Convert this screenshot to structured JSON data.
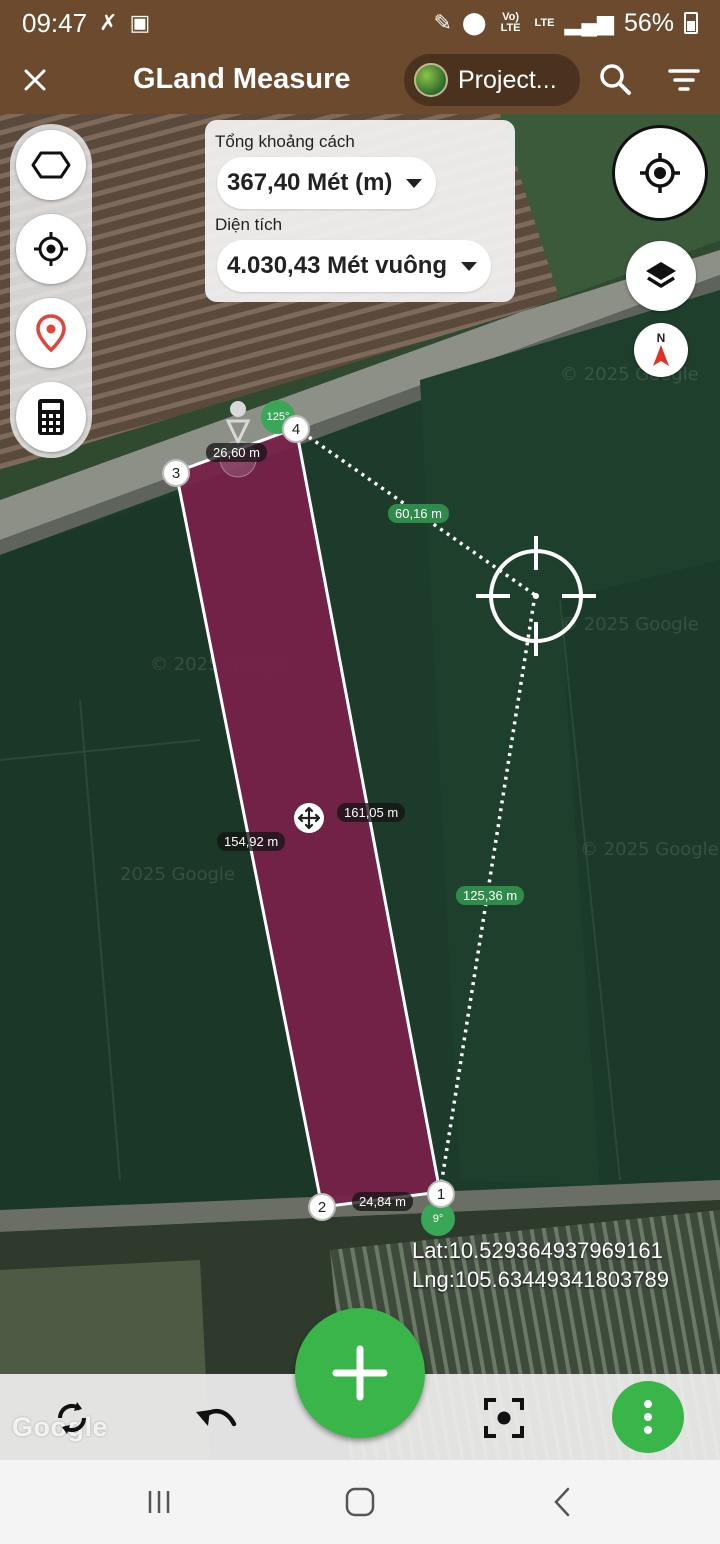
{
  "status_bar": {
    "time": "09:47",
    "battery": "56%",
    "network_volte": "Vo) LTE",
    "network_lte": "LTE"
  },
  "app_bar": {
    "title": "GLand Measure",
    "project_label": "Project..."
  },
  "info": {
    "total_distance_label": "Tổng khoảng cách",
    "total_distance_value": "367,40 Mét (m)",
    "area_label": "Diện tích",
    "area_value": "4.030,43 Mét vuông"
  },
  "compass": {
    "label": "N"
  },
  "map": {
    "vertices": [
      "1",
      "2",
      "3",
      "4"
    ],
    "segments": {
      "top": "26,60 m",
      "left": "154,92 m",
      "right": "161,05 m",
      "bottom": "24,84 m"
    },
    "guide_lines": {
      "to_vertex4": "60,16 m",
      "to_vertex1": "125,36 m"
    },
    "angles": {
      "vertex4": "125°",
      "vertex1": "9°"
    },
    "coordinates": {
      "lat": "Lat:10.529364937969161",
      "lng": "Lng:105.63449341803789"
    },
    "attribution": "Google"
  },
  "colors": {
    "app_bar": "#6b4a2e",
    "polygon_fill": "#7a1f4a",
    "accent_green": "#39b54a"
  }
}
